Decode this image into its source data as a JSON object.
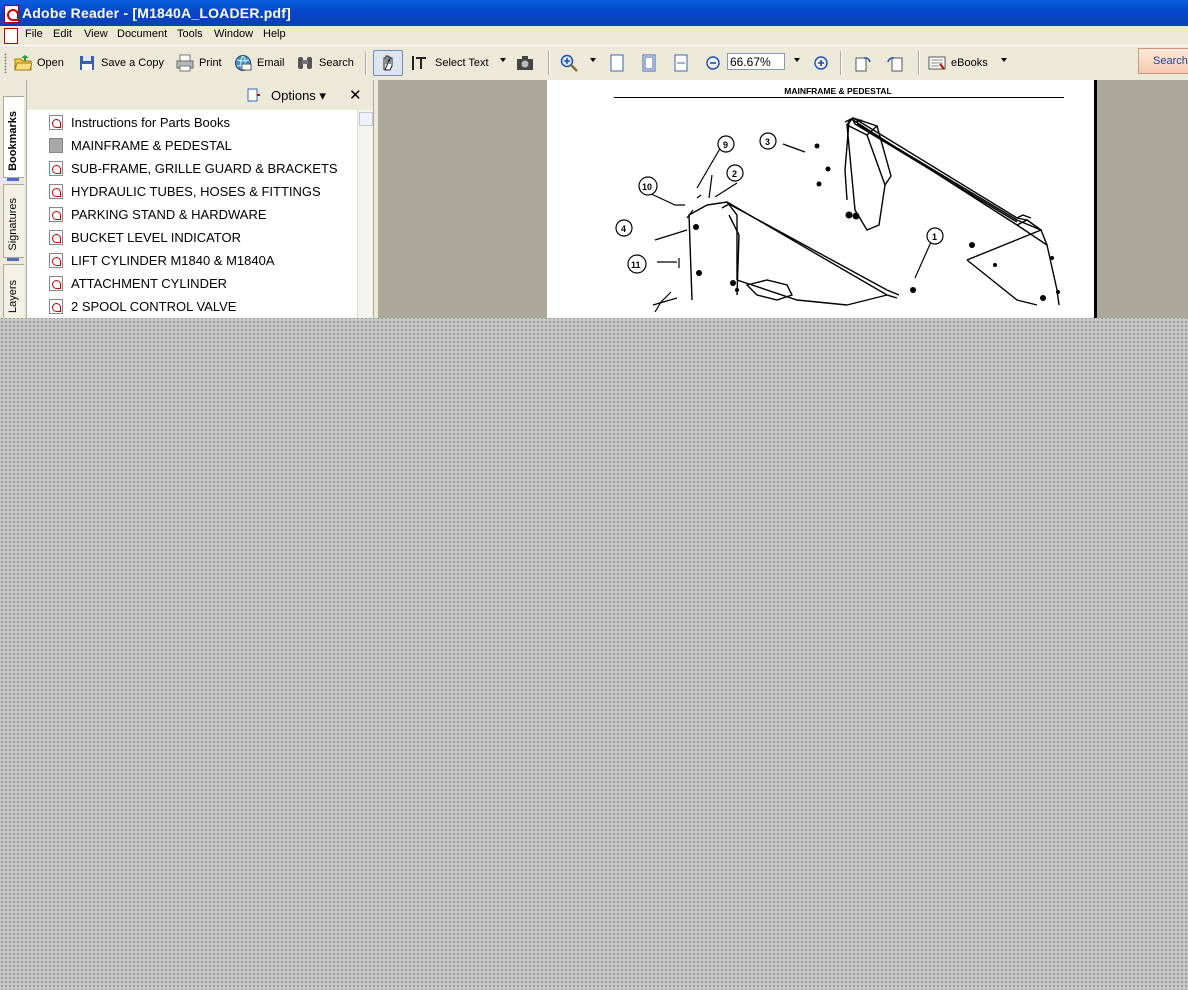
{
  "window": {
    "title": "Adobe Reader - [M1840A_LOADER.pdf]"
  },
  "menu": {
    "items": [
      "File",
      "Edit",
      "View",
      "Document",
      "Tools",
      "Window",
      "Help"
    ]
  },
  "toolbar": {
    "open": "Open",
    "save_copy": "Save a Copy",
    "print": "Print",
    "email": "Email",
    "search": "Search",
    "select_text": "Select Text",
    "zoom": "66.67%",
    "ebooks": "eBooks",
    "search_right": "Search"
  },
  "nav_tabs": [
    "Bookmarks",
    "Signatures",
    "Layers"
  ],
  "panel": {
    "options_label": "Options",
    "close_glyph": "✕",
    "bookmarks": [
      "Instructions for Parts Books",
      "MAINFRAME & PEDESTAL",
      "SUB-FRAME, GRILLE GUARD & BRACKETS",
      "HYDRAULIC TUBES, HOSES & FITTINGS",
      "PARKING STAND & HARDWARE",
      "BUCKET LEVEL INDICATOR",
      "LIFT CYLINDER M1840 & M1840A",
      "ATTACHMENT CYLINDER",
      "2 SPOOL CONTROL VALVE"
    ]
  },
  "document": {
    "page_title": "MAINFRAME & PEDESTAL",
    "callouts": [
      "1",
      "2",
      "3",
      "4",
      "9",
      "10",
      "11"
    ]
  }
}
